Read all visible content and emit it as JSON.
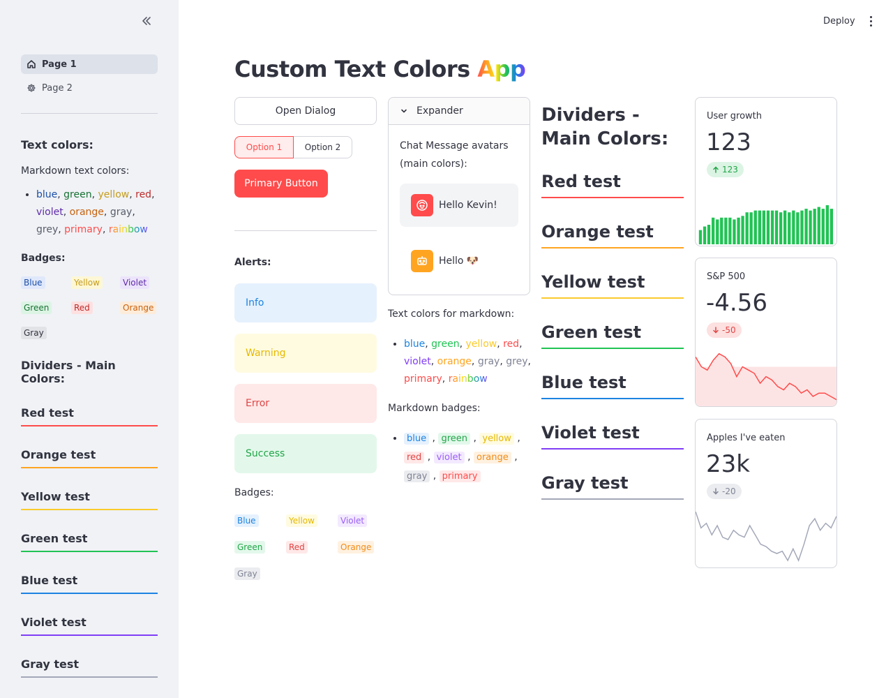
{
  "header": {
    "deploy_label": "Deploy"
  },
  "sidebar": {
    "nav": [
      {
        "label": "Page 1",
        "icon": "home-icon",
        "active": true
      },
      {
        "label": "Page 2",
        "icon": "gear-icon",
        "active": false
      }
    ],
    "text_colors_title": "Text colors:",
    "markdown_text_colors_label": "Markdown text colors:",
    "color_words": [
      "blue",
      "green",
      "yellow",
      "red",
      "violet",
      "orange",
      "gray",
      "grey",
      "primary",
      "rainbow"
    ],
    "badges_title": "Badges:",
    "badges": [
      "Blue",
      "Yellow",
      "Violet",
      "Green",
      "Red",
      "Orange",
      "Gray"
    ],
    "dividers_title": "Dividers - Main Colors:",
    "dividers": [
      "Red test",
      "Orange test",
      "Yellow test",
      "Green test",
      "Blue test",
      "Violet test",
      "Gray test"
    ]
  },
  "main": {
    "title_main": "Custom Text Colors ",
    "title_rainbow": "App",
    "open_dialog_label": "Open Dialog",
    "options": [
      "Option 1",
      "Option 2"
    ],
    "primary_button_label": "Primary Button",
    "alerts_title": "Alerts:",
    "alerts": [
      "Info",
      "Warning",
      "Error",
      "Success"
    ],
    "badges_title": "Badges:",
    "badges": [
      "Blue",
      "Yellow",
      "Violet",
      "Green",
      "Red",
      "Orange",
      "Gray"
    ],
    "expander": {
      "label": "Expander",
      "text": "Chat Message avatars (main colors):",
      "messages": [
        "Hello Kevin!",
        "Hello 🐶"
      ]
    },
    "text_colors_markdown_label": "Text colors for markdown:",
    "markdown_badges_label": "Markdown badges:",
    "markdown_badges": [
      "blue",
      "green",
      "yellow",
      "red",
      "violet",
      "orange",
      "gray",
      "primary"
    ],
    "dividers_title": "Dividers - Main Colors:",
    "dividers": [
      "Red test",
      "Orange test",
      "Yellow test",
      "Green test",
      "Blue test",
      "Violet test",
      "Gray test"
    ]
  },
  "metrics": [
    {
      "label": "User growth",
      "value": "123",
      "delta": "123",
      "direction": "up"
    },
    {
      "label": "S&P 500",
      "value": "-4.56",
      "delta": "-50",
      "direction": "down"
    },
    {
      "label": "Apples I've eaten",
      "value": "23k",
      "delta": "-20",
      "direction": "down"
    }
  ],
  "colors": {
    "red": "#ff4b4b",
    "orange": "#ffa421",
    "yellow": "#faca2b",
    "green": "#21c354",
    "blue": "#1c83e1",
    "violet": "#803df5",
    "gray": "#a3a8b8",
    "text_blue": "#1c4fa8",
    "text_green": "#177233",
    "text_yellow": "#c69c1b",
    "text_red": "#bd2b2b",
    "text_violet": "#5f2aa8",
    "text_orange": "#c9610d",
    "text_gray": "#5a5d69"
  },
  "chart_data": [
    {
      "type": "bar",
      "title": "User growth",
      "values": [
        8,
        10,
        11,
        15,
        14,
        15,
        15,
        15,
        14,
        15,
        16,
        18,
        18,
        19,
        19,
        19,
        19,
        19,
        19,
        18,
        19,
        18,
        19,
        18,
        19,
        20,
        19,
        20,
        21,
        20,
        22,
        20
      ],
      "ylim": [
        0,
        22
      ]
    },
    {
      "type": "area",
      "title": "S&P 500",
      "values": [
        3,
        0,
        -1,
        2,
        4,
        3,
        1,
        -3,
        0,
        -1,
        -2,
        -5,
        -3,
        -4,
        -6,
        -7,
        -5,
        -6,
        -8,
        -7,
        -9,
        -8,
        -8,
        -9,
        -10
      ],
      "ylim": [
        -12,
        5
      ]
    },
    {
      "type": "line",
      "title": "Apples I've eaten",
      "values": [
        10,
        3,
        5,
        0,
        4,
        -1,
        -2,
        2,
        0,
        -1,
        4,
        0,
        -4,
        -5,
        -7,
        -8,
        -7,
        -11,
        -6,
        -11,
        -4,
        4,
        7,
        2,
        5,
        3,
        8
      ],
      "ylim": [
        -14,
        10
      ]
    }
  ]
}
